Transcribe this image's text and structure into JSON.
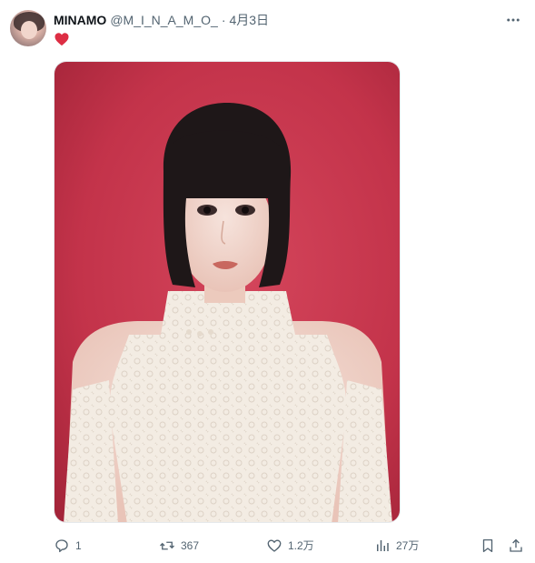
{
  "author": {
    "display_name": "MINAMO",
    "handle": "@M_I_N_A_M_O_",
    "separator": "·",
    "date": "4月3日"
  },
  "post": {
    "text_icon": "red-heart-emoji",
    "heart_color": "#e0245e"
  },
  "photo": {
    "background_color": "#c5334a"
  },
  "actions": {
    "reply_count": "1",
    "repost_count": "367",
    "like_count": "1.2万",
    "view_count": "27万"
  },
  "icons": {
    "more": "more-icon",
    "reply": "reply-icon",
    "repost": "repost-icon",
    "like": "like-icon",
    "views": "views-icon",
    "bookmark": "bookmark-icon",
    "share": "share-icon"
  },
  "colors": {
    "text_primary": "#0f1419",
    "text_secondary": "#536471"
  }
}
